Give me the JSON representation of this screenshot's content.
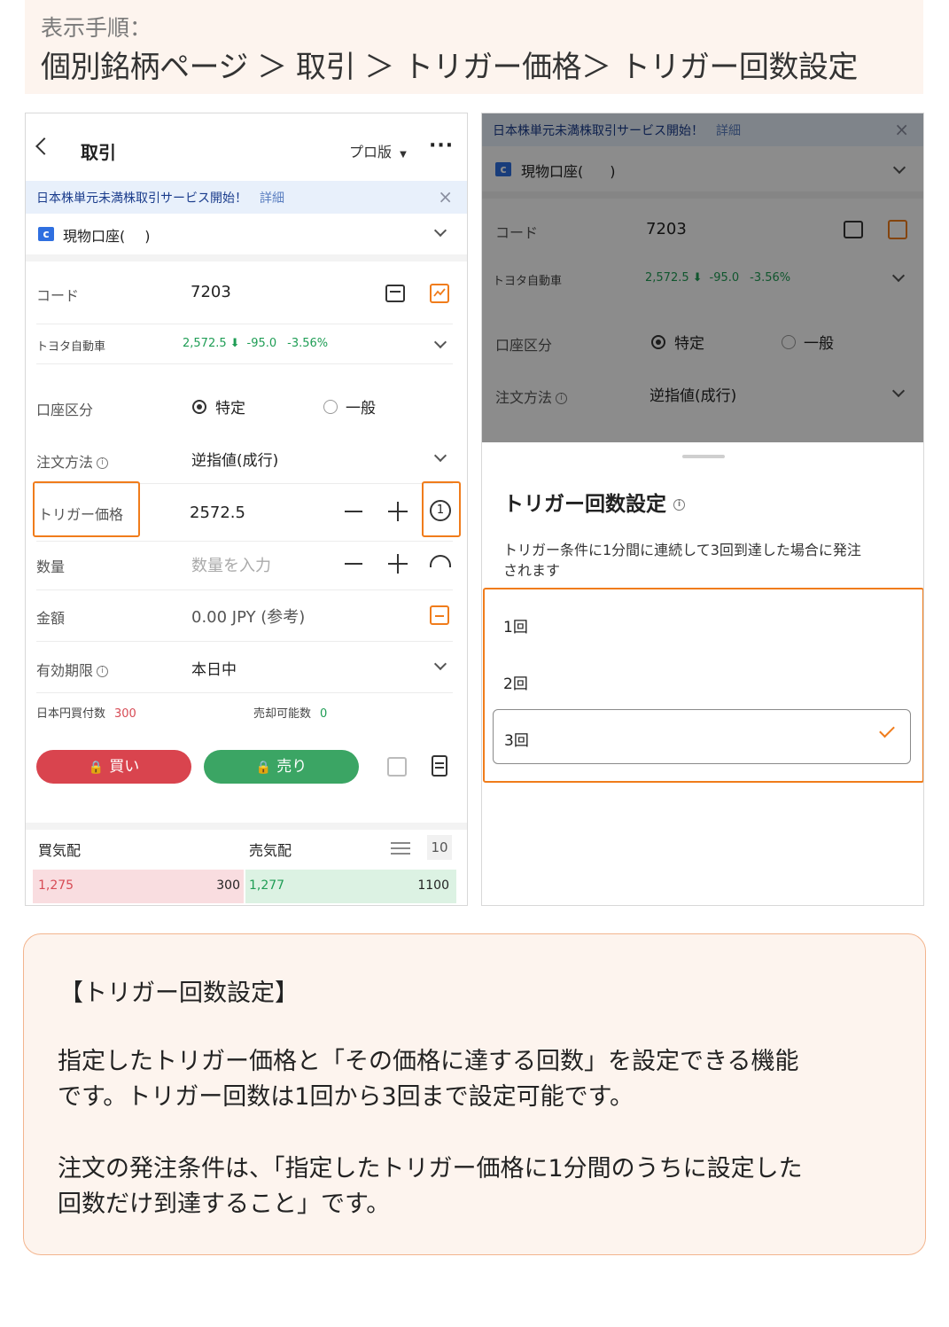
{
  "header": {
    "steps_label": "表示手順：",
    "path": "個別銘柄ページ ＞ 取引 ＞ トリガー価格＞ トリガー回数設定"
  },
  "left": {
    "title": "取引",
    "pro_label": "プロ版",
    "more": "···",
    "banner": {
      "text": "日本株単元未満株取引サービス開始！",
      "link": "詳細"
    },
    "account": {
      "name": "現物口座(",
      "suffix": ")"
    },
    "code_label": "コード",
    "code_value": "7203",
    "stock_name": "トヨタ自動車",
    "price": "2,572.5",
    "change": "-95.0",
    "change_pct": "-3.56%",
    "account_type_label": "口座区分",
    "account_type_opt1": "特定",
    "account_type_opt2": "一般",
    "order_method_label": "注文方法",
    "order_method_value": "逆指値(成行)",
    "trigger_label": "トリガー価格",
    "trigger_value": "2572.5",
    "trigger_icon_digit": "1",
    "qty_label": "数量",
    "qty_placeholder": "数量を入力",
    "amount_label": "金額",
    "amount_value": "0.00 JPY (参考)",
    "validity_label": "有効期限",
    "validity_value": "本日中",
    "buyable_label": "日本円買付数",
    "buyable_value": "300",
    "sellable_label": "売却可能数",
    "sellable_value": "0",
    "buy_button": "買い",
    "sell_button": "売り",
    "bid_label": "買気配",
    "ask_label": "売気配",
    "depth": "10",
    "bid_price": "1,275",
    "bid_qty": "300",
    "ask_price": "1,277",
    "ask_qty": "1100"
  },
  "right": {
    "banner": {
      "text": "日本株単元未満株取引サービス開始！",
      "link": "詳細"
    },
    "account": {
      "name": "現物口座(",
      "suffix": ")"
    },
    "code_label": "コード",
    "code_value": "7203",
    "stock_name": "トヨタ自動車",
    "price": "2,572.5",
    "change": "-95.0",
    "change_pct": "-3.56%",
    "account_type_label": "口座区分",
    "account_type_opt1": "特定",
    "account_type_opt2": "一般",
    "order_method_label": "注文方法",
    "order_method_value": "逆指値(成行)",
    "sheet": {
      "title": "トリガー回数設定",
      "description_line1": "トリガー条件に1分間に連続して3回到達した場合に発注",
      "description_line2": "されます",
      "options": [
        "1回",
        "2回",
        "3回"
      ],
      "selected": "3回"
    }
  },
  "note": {
    "title": "【トリガー回数設定】",
    "p1_line1": "指定したトリガー価格と「その価格に達する回数」を設定できる機能",
    "p1_line2": "です。トリガー回数は1回から3回まで設定可能です。",
    "p2_line1": "注文の発注条件は、「指定したトリガー価格に1分間のうちに設定した",
    "p2_line2": "回数だけ到達すること」です。"
  },
  "colors": {
    "accent_orange": "#f07c1b",
    "buy_red": "#d9444e",
    "sell_green": "#3ba564",
    "header_bg": "#fdf4ee",
    "banner_bg": "#e8f0fb"
  }
}
